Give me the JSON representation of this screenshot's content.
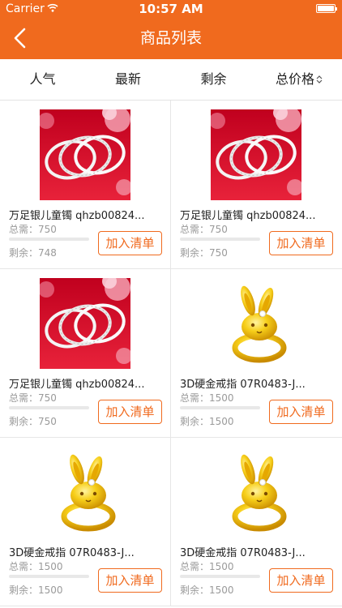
{
  "status_bar": {
    "carrier": "Carrier",
    "time": "10:57 AM"
  },
  "header": {
    "title": "商品列表",
    "back_icon": "chevron-left-icon"
  },
  "sort_bar": {
    "tabs": [
      {
        "label": "人气"
      },
      {
        "label": "最新"
      },
      {
        "label": "剩余"
      },
      {
        "label": "总价格",
        "icon": "sort-arrows-icon"
      }
    ]
  },
  "colors": {
    "accent": "#f06a1e",
    "bracelet_background": "#d8102a",
    "ring_gold": "#f2c200"
  },
  "products": [
    {
      "name": "万足银儿童镯 qhzb00824...",
      "need": "总需：750",
      "left": "剩余：748",
      "button": "加入清单",
      "image": "silver-bracelet"
    },
    {
      "name": "万足银儿童镯 qhzb00824...",
      "need": "总需：750",
      "left": "剩余：750",
      "button": "加入清单",
      "image": "silver-bracelet"
    },
    {
      "name": "万足银儿童镯 qhzb00824...",
      "need": "总需：750",
      "left": "剩余：750",
      "button": "加入清单",
      "image": "silver-bracelet"
    },
    {
      "name": "3D硬金戒指 07R0483-J...",
      "need": "总需：1500",
      "left": "剩余：1500",
      "button": "加入清单",
      "image": "gold-bunny-ring"
    },
    {
      "name": "3D硬金戒指 07R0483-J...",
      "need": "总需：1500",
      "left": "剩余：1500",
      "button": "加入清单",
      "image": "gold-bunny-ring"
    },
    {
      "name": "3D硬金戒指 07R0483-J...",
      "need": "总需：1500",
      "left": "剩余：1500",
      "button": "加入清单",
      "image": "gold-bunny-ring"
    }
  ]
}
